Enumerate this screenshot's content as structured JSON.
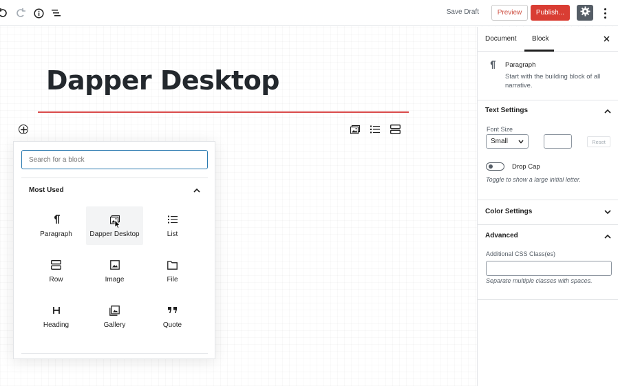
{
  "toolbar": {
    "save_draft": "Save Draft",
    "preview": "Preview",
    "publish": "Publish...",
    "accent_color": "#d93d33"
  },
  "post": {
    "title": "Dapper Desktop"
  },
  "inserter": {
    "search_placeholder": "Search for a block",
    "section_title": "Most Used",
    "blocks": [
      {
        "label": "Paragraph",
        "icon": "paragraph-icon"
      },
      {
        "label": "Dapper Desktop",
        "icon": "dapper-desktop-icon"
      },
      {
        "label": "List",
        "icon": "list-icon"
      },
      {
        "label": "Row",
        "icon": "row-icon"
      },
      {
        "label": "Image",
        "icon": "image-icon"
      },
      {
        "label": "File",
        "icon": "file-icon"
      },
      {
        "label": "Heading",
        "icon": "heading-icon"
      },
      {
        "label": "Gallery",
        "icon": "gallery-icon"
      },
      {
        "label": "Quote",
        "icon": "quote-icon"
      }
    ]
  },
  "sidebar": {
    "tabs": [
      "Document",
      "Block"
    ],
    "active_tab": "Block",
    "block_card": {
      "title": "Paragraph",
      "description": "Start with the building block of all narrative."
    },
    "text_settings": {
      "title": "Text Settings",
      "font_size_label": "Font Size",
      "font_size_value": "Small",
      "reset": "Reset",
      "drop_cap_label": "Drop Cap",
      "drop_cap_help": "Toggle to show a large initial letter."
    },
    "color_settings": {
      "title": "Color Settings"
    },
    "advanced": {
      "title": "Advanced",
      "css_label": "Additional CSS Class(es)",
      "css_help": "Separate multiple classes with spaces."
    }
  }
}
